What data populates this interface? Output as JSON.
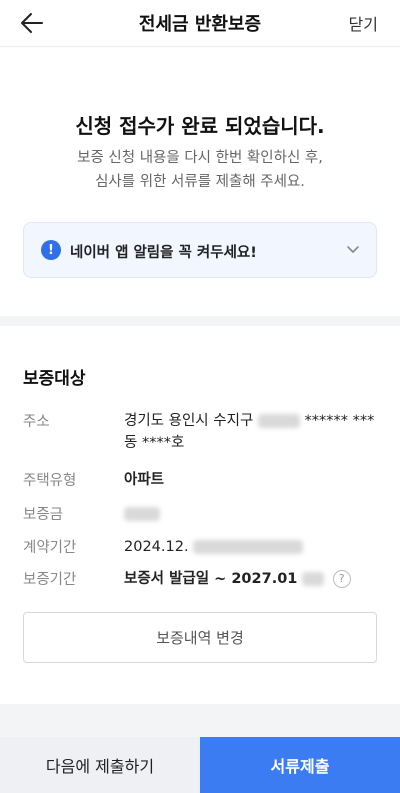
{
  "header": {
    "back_icon": "arrow-left-icon",
    "title": "전세금 반환보증",
    "close_label": "닫기"
  },
  "hero": {
    "title": "신청 접수가 완료 되었습니다.",
    "desc_line1": "보증 신청 내용을 다시 한번 확인하신 후,",
    "desc_line2": "심사를 위한 서류를 제출해 주세요."
  },
  "notice": {
    "icon": "info-icon",
    "icon_glyph": "!",
    "text": "네이버 앱 알림을 꼭 켜두세요!",
    "chevron_icon": "chevron-down-icon"
  },
  "section": {
    "title": "보증대상",
    "rows": [
      {
        "label": "주소",
        "value_part1": "경기도 용인시 수지구",
        "value_part2": "****** ***",
        "value_part3": "동 ****호"
      },
      {
        "label": "주택유형",
        "value": "아파트"
      },
      {
        "label": "보증금",
        "value": ""
      },
      {
        "label": "계약기간",
        "value": "2024.12."
      },
      {
        "label": "보증기간",
        "value": "보증서 발급일 ~ 2027.01",
        "help_glyph": "?"
      }
    ],
    "change_button": "보증내역 변경"
  },
  "bottom": {
    "later_label": "다음에 제출하기",
    "submit_label": "서류제출"
  },
  "colors": {
    "accent": "#3b7cf2",
    "notice_bg": "#f1f6ff",
    "info_icon": "#2f6fe8"
  }
}
